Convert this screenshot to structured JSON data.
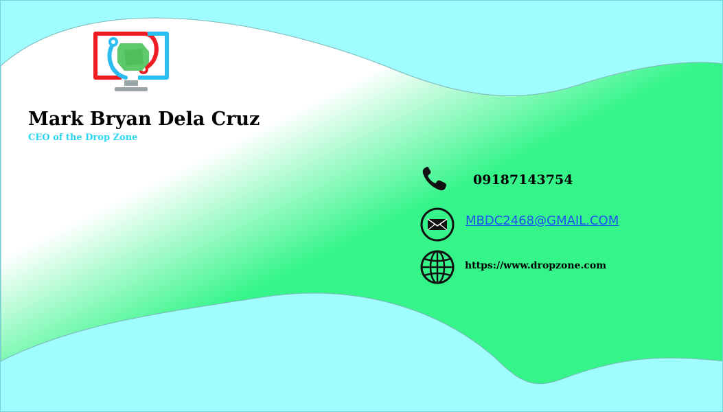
{
  "card": {
    "name": "Mark Bryan Dela Cruz",
    "title": "CEO of the Drop Zone"
  },
  "contact": {
    "phone": "09187143754",
    "email": "MBDC2468@GMAIL.COM",
    "website": "https://www.dropzone.com"
  },
  "icons": {
    "logo": "monitor-logo-icon",
    "phone": "phone-icon",
    "email": "envelope-icon",
    "website": "globe-icon"
  },
  "colors": {
    "background_cyan": "#9ffcff",
    "wave_green": "#35f58a",
    "title_cyan": "#2ad6f0",
    "email_blue": "#1f4ff0",
    "logo_red": "#ee1d23",
    "logo_blue": "#2bbdf0",
    "logo_green": "#5ec96a"
  }
}
